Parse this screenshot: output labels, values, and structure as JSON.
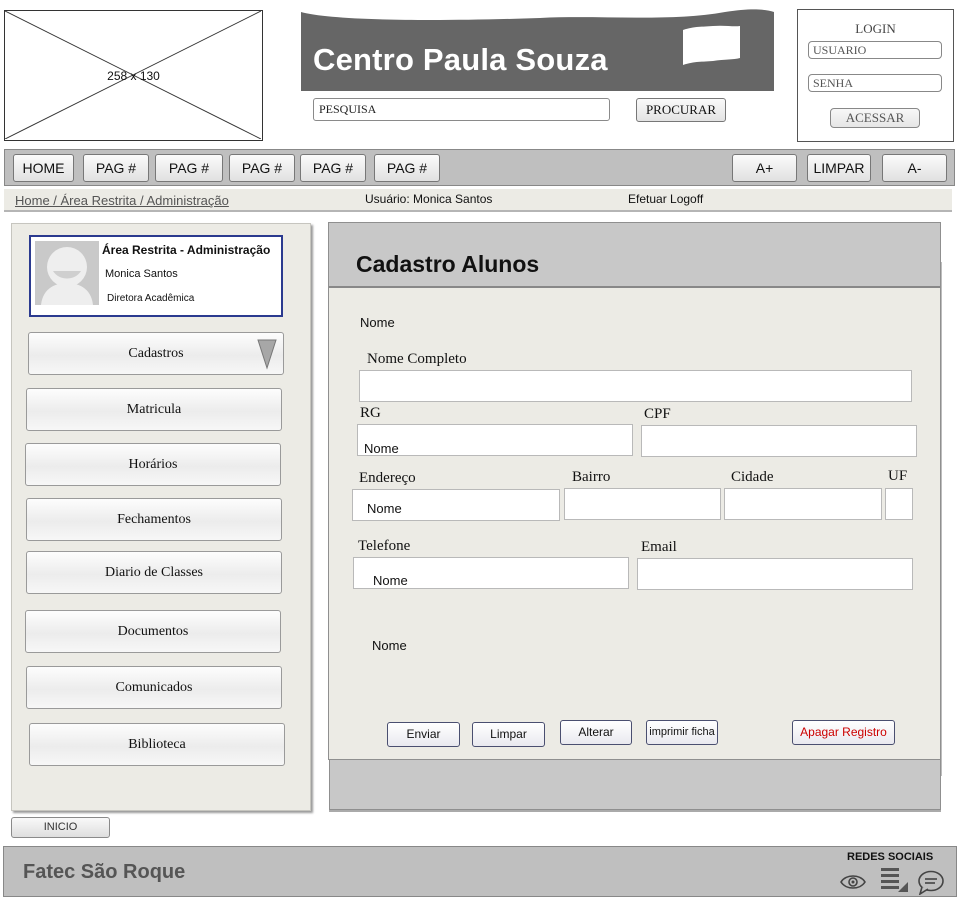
{
  "logo_placeholder": {
    "label": "258 x 130"
  },
  "banner": {
    "title": "Centro Paula Souza"
  },
  "search": {
    "value": "PESQUISA",
    "button": "PROCURAR"
  },
  "login": {
    "title": "LOGIN",
    "user_placeholder": "USUARIO",
    "password_placeholder": "SENHA",
    "submit": "ACESSAR"
  },
  "nav": {
    "items": [
      "HOME",
      "PAG #",
      "PAG #",
      "PAG #",
      "PAG #",
      "PAG #"
    ],
    "font_increase": "A+",
    "clear": "LIMPAR",
    "font_decrease": "A-"
  },
  "breadcrumb": {
    "path": "Home / Área Restrita / Administração",
    "user": "Usuário: Monica Santos",
    "logoff": "Efetuar Logoff"
  },
  "profile": {
    "heading": "Área Restrita - Administração",
    "name": "Monica Santos",
    "role": "Diretora Acadêmica"
  },
  "sidebar": {
    "items": [
      "Cadastros",
      "Matricula",
      "Horários",
      "Fechamentos",
      "Diario de Classes",
      "Documentos",
      "Comunicados",
      "Biblioteca"
    ]
  },
  "form": {
    "title": "Cadastro Alunos",
    "top_label": "Nome",
    "full_name_label": "Nome Completo",
    "rg_label": "RG",
    "rg_value": "Nome",
    "cpf_label": "CPF",
    "address_label": "Endereço",
    "address_value": "Nome",
    "district_label": "Bairro",
    "city_label": "Cidade",
    "state_label": "UF",
    "phone_label": "Telefone",
    "phone_value": "Nome",
    "email_label": "Email",
    "extra_label": "Nome",
    "buttons": {
      "send": "Enviar",
      "clear": "Limpar",
      "edit": "Alterar",
      "print": "imprimir ficha",
      "delete": "Apagar Registro"
    }
  },
  "inicio_button": "INICIO",
  "footer": {
    "title": "Fatec São Roque",
    "social_label": "REDES SOCIAIS"
  },
  "colors": {
    "banner": "#666666",
    "nav_bar": "#bfbfbf",
    "panel": "#ecebe5",
    "profile_border": "#2b3a8f",
    "delete_text": "#cc0000"
  }
}
